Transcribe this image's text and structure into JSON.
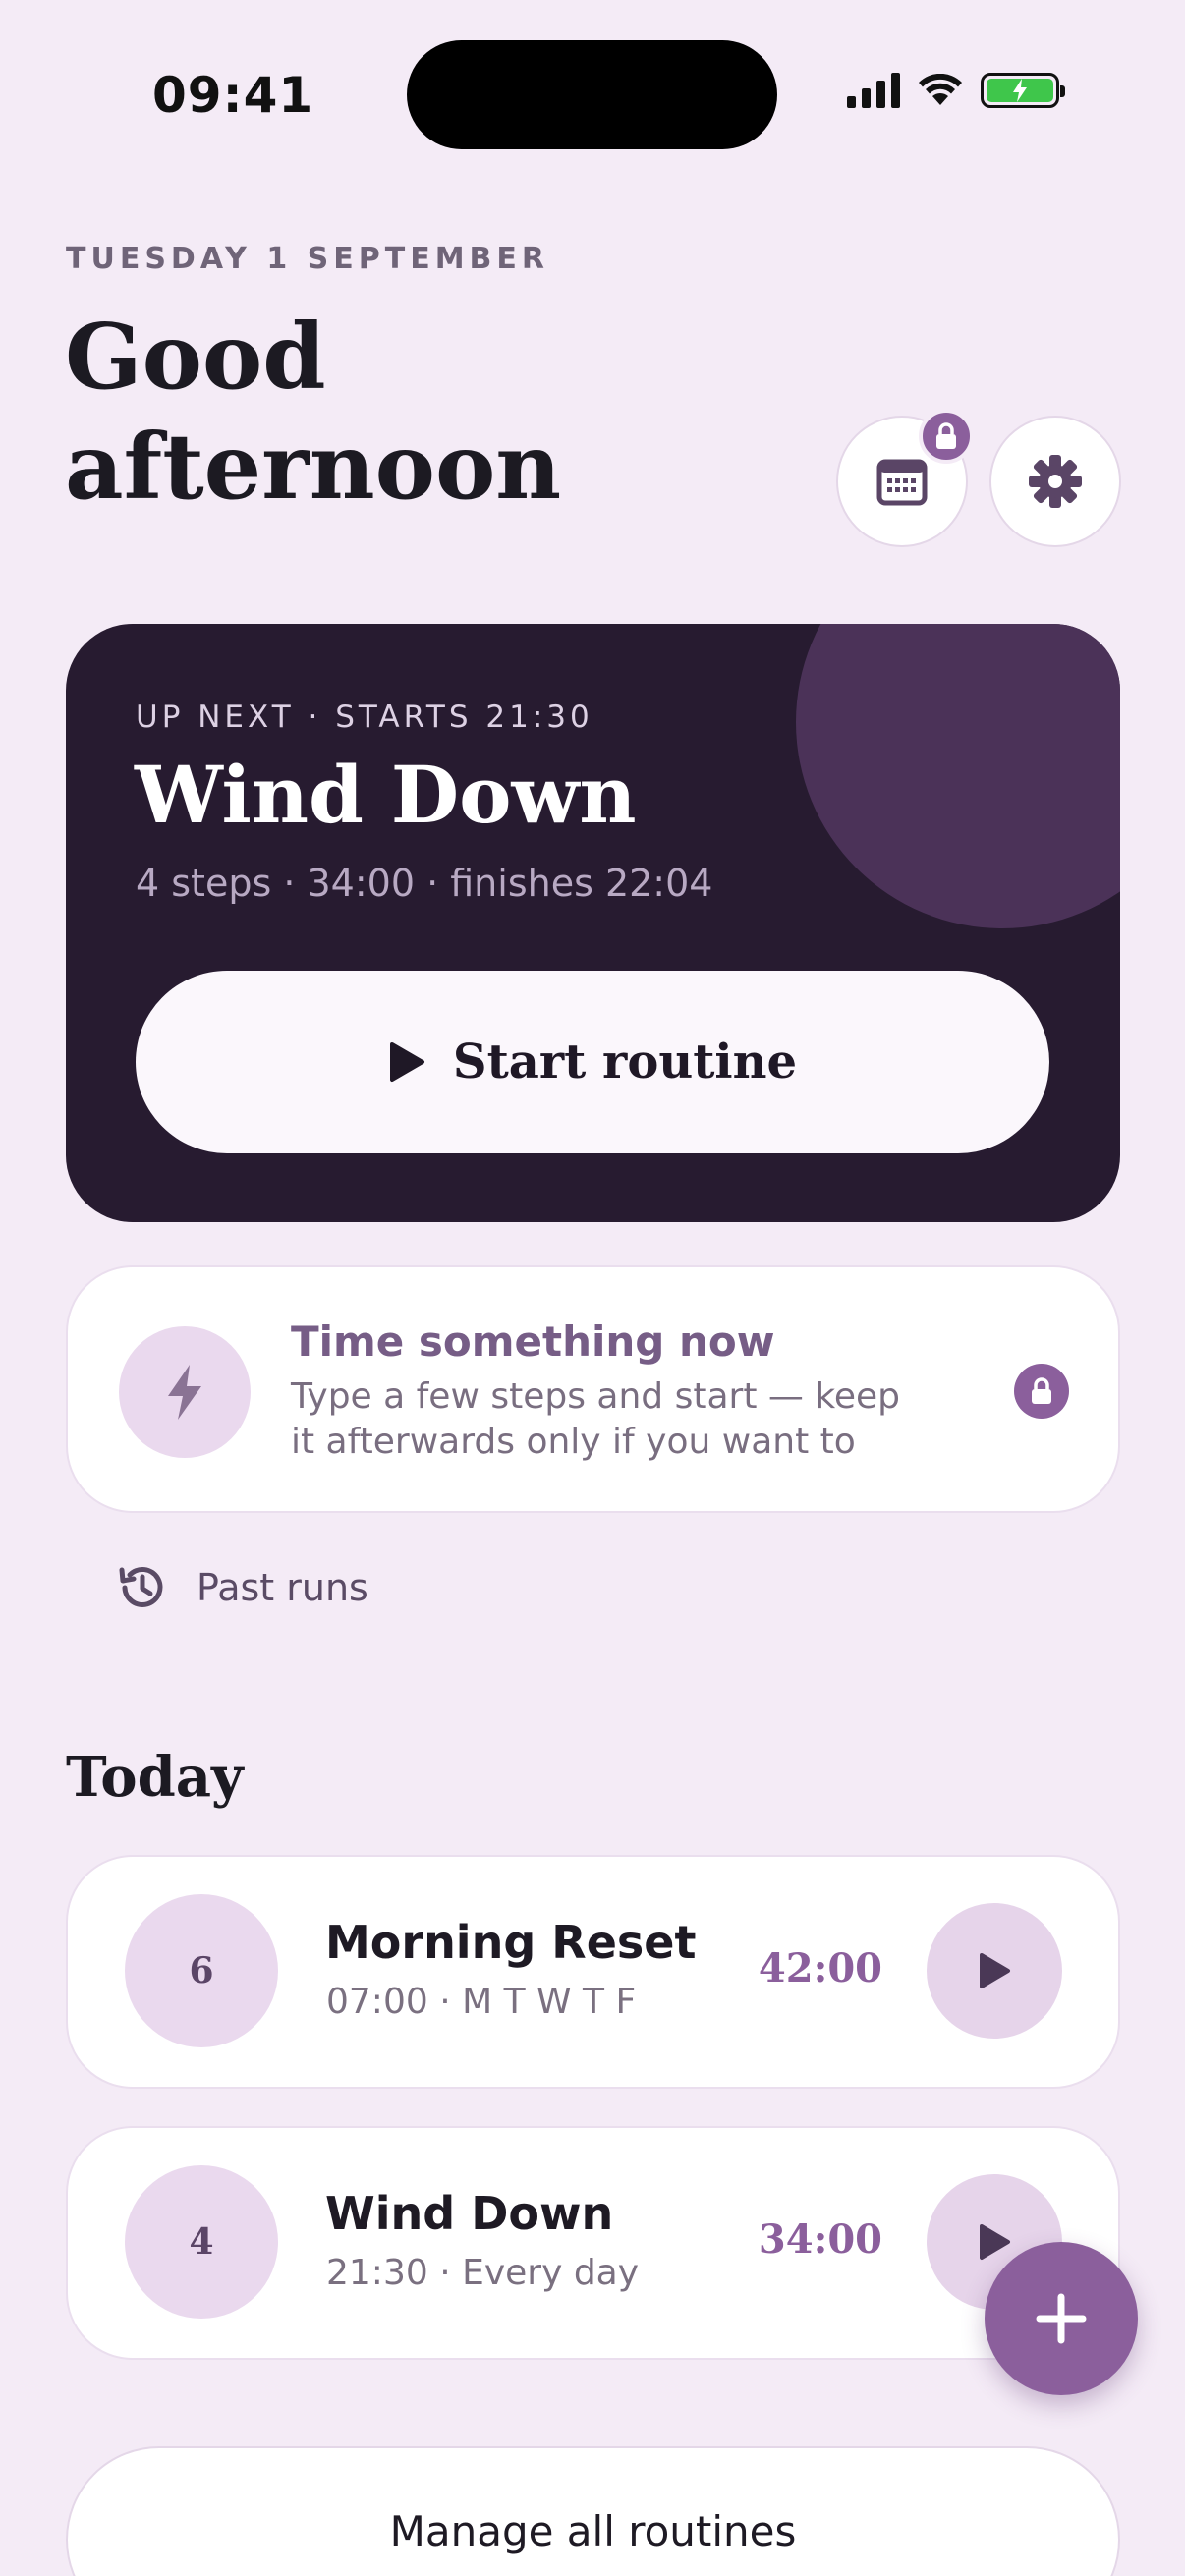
{
  "status_bar": {
    "time": "09:41",
    "icons": [
      "cellular-signal-icon",
      "wifi-icon",
      "battery-charging-icon"
    ],
    "battery_color": "#3fc64b"
  },
  "header": {
    "date": "TUESDAY 1 SEPTEMBER",
    "greeting": "Good afternoon",
    "calendar_button_icon": "calendar-icon",
    "calendar_locked_icon": "lock-icon",
    "settings_button_icon": "gear-icon"
  },
  "up_next": {
    "label": "UP NEXT · STARTS 21:30",
    "title": "Wind Down",
    "meta": "4 steps · 34:00 · finishes 22:04",
    "start_label": "Start routine",
    "start_icon": "play-icon"
  },
  "quick_timer": {
    "title": "Time something now",
    "description": "Type a few steps and start — keep it afterwards only if you want to",
    "icon": "lightning-icon",
    "locked_icon": "lock-icon"
  },
  "past_runs": {
    "label": "Past runs",
    "icon": "history-icon"
  },
  "today": {
    "heading": "Today",
    "routines": [
      {
        "count": "6",
        "name": "Morning Reset",
        "schedule": "07:00 · M T W T F",
        "duration": "42:00"
      },
      {
        "count": "4",
        "name": "Wind Down",
        "schedule": "21:30 · Every day",
        "duration": "34:00"
      }
    ]
  },
  "fab": {
    "icon": "plus-icon"
  },
  "manage": {
    "label": "Manage all routines"
  },
  "colors": {
    "background": "#f4ebf6",
    "accent": "#8b5f9c",
    "card_dark": "#271b30",
    "soft_purple": "#ead9ee"
  }
}
